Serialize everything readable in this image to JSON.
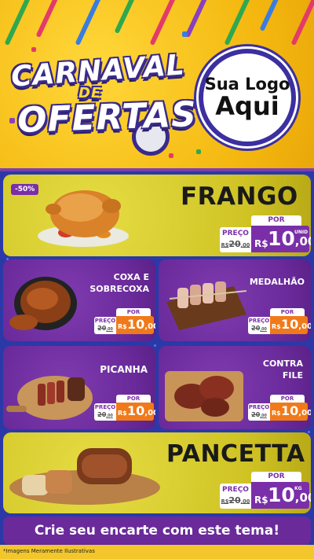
{
  "header": {
    "title_line1": "CARNAVAL",
    "title_line2": "DE",
    "title_line3": "OFERTAS",
    "logo_line1": "Sua Logo",
    "logo_line2": "Aqui"
  },
  "products": [
    {
      "name": "FRANGO",
      "discount_badge": "-50%",
      "por_label": "POR",
      "preco_label": "PREÇO",
      "old_price": "20",
      "old_cents": ",00",
      "currency": "R$",
      "price": "10",
      "cents": ",00",
      "unit": "UNID"
    },
    {
      "name_line1": "COXA E",
      "name_line2": "SOBRECOXA",
      "por_label": "POR",
      "preco_label": "PREÇO",
      "old_price": "20",
      "old_cents": ",00",
      "currency": "R$",
      "price": "10",
      "cents": ",00"
    },
    {
      "name": "MEDALHÃO",
      "por_label": "POR",
      "preco_label": "PREÇO",
      "old_price": "20",
      "old_cents": ",00",
      "currency": "R$",
      "price": "10",
      "cents": ",00"
    },
    {
      "name": "PICANHA",
      "por_label": "POR",
      "preco_label": "PREÇO",
      "old_price": "20",
      "old_cents": ",00",
      "currency": "R$",
      "price": "10",
      "cents": ",00"
    },
    {
      "name_line1": "CONTRA",
      "name_line2": "FILE",
      "por_label": "POR",
      "preco_label": "PREÇO",
      "old_price": "20",
      "old_cents": ",00",
      "currency": "R$",
      "price": "10",
      "cents": ",00"
    },
    {
      "name": "PANCETTA",
      "por_label": "POR",
      "preco_label": "PREÇO",
      "old_price": "20",
      "old_cents": ",00",
      "currency": "R$",
      "price": "10",
      "cents": ",00",
      "unit": "KG"
    }
  ],
  "cta": {
    "label": "Crie seu encarte com este tema!"
  },
  "footer": {
    "disclaimer": "*Imagens Meramente Ilustrativas"
  },
  "colors": {
    "purple": "#6a2a9a",
    "yellow": "#f5c21b",
    "orange": "#f07a1a",
    "blue": "#2b39a8"
  }
}
